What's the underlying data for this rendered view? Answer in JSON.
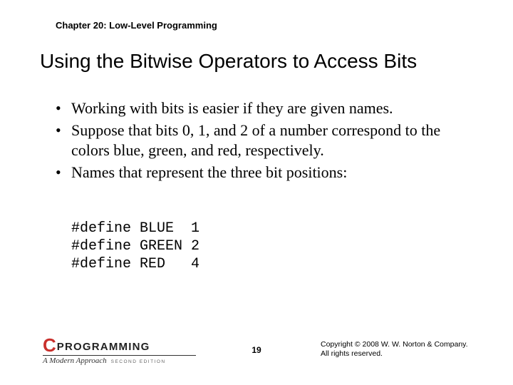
{
  "chapter": "Chapter 20: Low-Level Programming",
  "title": "Using the Bitwise Operators to Access Bits",
  "bullets": [
    "Working with bits is easier if they are given names.",
    "Suppose that bits 0, 1, and 2 of a number correspond to the colors blue, green, and red, respectively.",
    "Names that represent the three bit positions:"
  ],
  "code": "#define BLUE  1\n#define GREEN 2\n#define RED   4",
  "logo": {
    "c": "C",
    "word": "PROGRAMMING",
    "sub_main": "A Modern Approach",
    "sub_ed": "SECOND EDITION"
  },
  "page_number": "19",
  "copyright_line1": "Copyright © 2008 W. W. Norton & Company.",
  "copyright_line2": "All rights reserved."
}
